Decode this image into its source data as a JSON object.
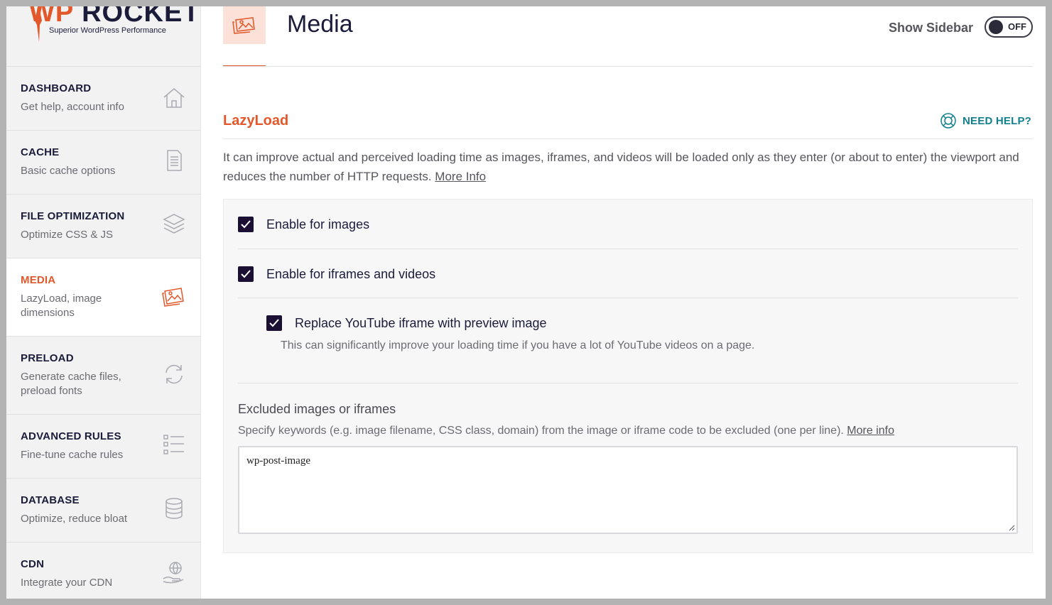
{
  "brand": {
    "wp": "WP",
    "rocket": "ROCKET",
    "tagline": "Superior WordPress Performance"
  },
  "sidebar": {
    "items": [
      {
        "title": "DASHBOARD",
        "subtitle": "Get help, account info",
        "icon": "home-icon"
      },
      {
        "title": "CACHE",
        "subtitle": "Basic cache options",
        "icon": "document-icon"
      },
      {
        "title": "FILE OPTIMIZATION",
        "subtitle": "Optimize CSS & JS",
        "icon": "layers-icon"
      },
      {
        "title": "MEDIA",
        "subtitle": "LazyLoad, image dimensions",
        "icon": "images-icon",
        "active": true
      },
      {
        "title": "PRELOAD",
        "subtitle": "Generate cache files, preload fonts",
        "icon": "refresh-icon"
      },
      {
        "title": "ADVANCED RULES",
        "subtitle": "Fine-tune cache rules",
        "icon": "list-icon"
      },
      {
        "title": "DATABASE",
        "subtitle": "Optimize, reduce bloat",
        "icon": "database-icon"
      },
      {
        "title": "CDN",
        "subtitle": "Integrate your CDN",
        "icon": "globe-hand-icon"
      }
    ]
  },
  "header": {
    "title": "Media",
    "show_sidebar_label": "Show Sidebar",
    "toggle_state": "OFF"
  },
  "lazyload": {
    "title": "LazyLoad",
    "help_label": "NEED HELP?",
    "description": "It can improve actual and perceived loading time as images, iframes, and videos will be loaded only as they enter (or about to enter) the viewport and reduces the number of HTTP requests.",
    "more_info": "More Info",
    "options": {
      "images": {
        "label": "Enable for images",
        "checked": true
      },
      "iframes": {
        "label": "Enable for iframes and videos",
        "checked": true
      },
      "youtube": {
        "label": "Replace YouTube iframe with preview image",
        "checked": true,
        "help": "This can significantly improve your loading time if you have a lot of YouTube videos on a page."
      }
    },
    "excluded": {
      "title": "Excluded images or iframes",
      "description": "Specify keywords (e.g. image filename, CSS class, domain) from the image or iframe code to be excluded (one per line).",
      "more_info": "More info",
      "value": "wp-post-image"
    }
  },
  "colors": {
    "accent": "#e3582a",
    "navy": "#1b1b3a",
    "teal": "#127f8e",
    "checkbox": "#1b1034"
  }
}
